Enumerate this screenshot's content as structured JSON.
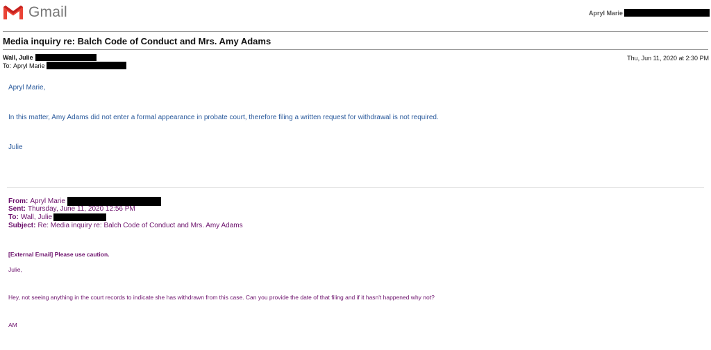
{
  "app": {
    "name": "Gmail",
    "brand_red": "#ea4335"
  },
  "account": {
    "name": "Apryl Marie"
  },
  "thread": {
    "subject": "Media inquiry re: Balch Code of Conduct and Mrs. Amy Adams"
  },
  "message": {
    "from_name": "Wall, Julie",
    "to_label": "To:",
    "to_name": "Apryl Marie",
    "date": "Thu, Jun 11, 2020 at 2:30 PM",
    "body": {
      "greeting": "Apryl Marie,",
      "paragraph": "In this matter, Amy Adams did not enter a formal appearance in probate court, therefore filing a written request for withdrawal is not required.",
      "signoff": "Julie"
    }
  },
  "quoted": {
    "from_label": "From:",
    "from_value": "Apryl Marie",
    "sent_label": "Sent:",
    "sent_value": "Thursday, June 11, 2020 12:56 PM",
    "to_label": "To:",
    "to_value": "Wall, Julie",
    "subject_label": "Subject:",
    "subject_value": "Re: Media inquiry re: Balch Code of Conduct and Mrs. Amy Adams",
    "warning": "[External Email] Please use caution.",
    "greeting": "Julie,",
    "paragraph": "Hey, not seeing anything in the court records to indicate she has withdrawn from this case. Can you provide the date of that filing and if it hasn't happened why not?",
    "signoff": "AM"
  },
  "colors": {
    "body_blue": "#2a5a9c",
    "quote_purple": "#6b0f6b",
    "redaction": "#000000"
  }
}
